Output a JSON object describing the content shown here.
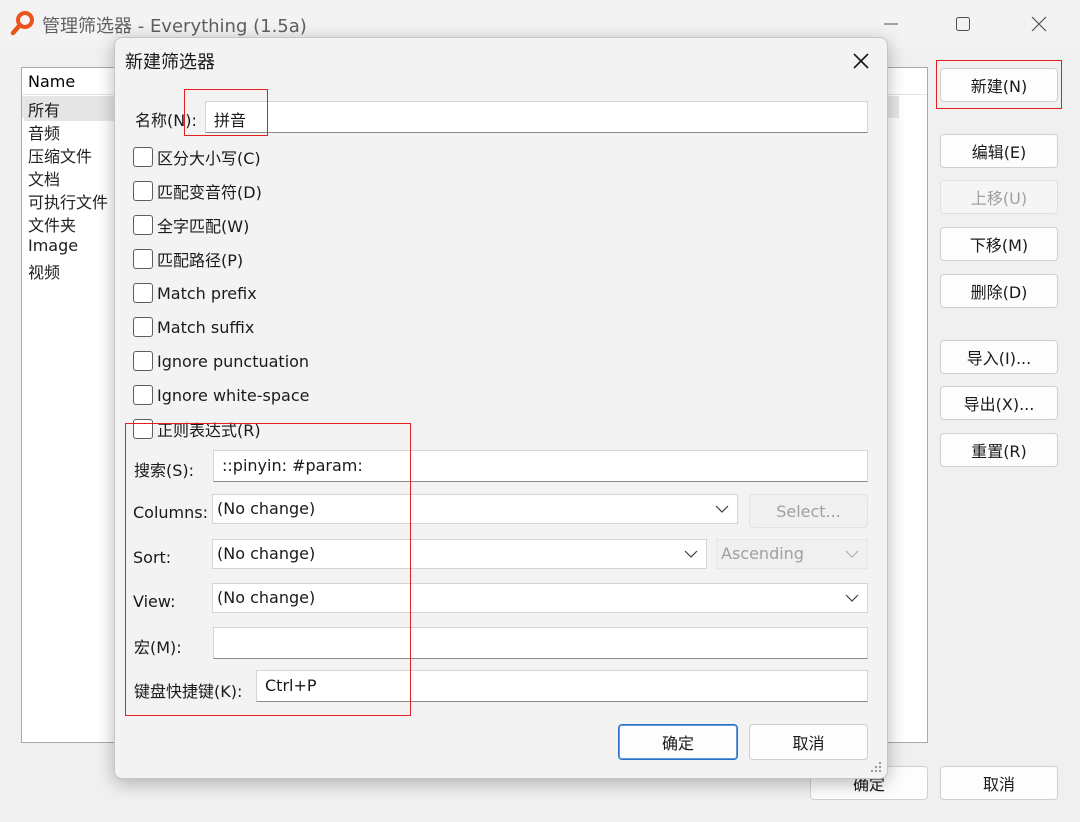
{
  "main_window": {
    "title": "管理筛选器 - Everything (1.5a)",
    "list_header": "Name",
    "filters": [
      "所有",
      "音频",
      "压缩文件",
      "文档",
      "可执行文件",
      "文件夹",
      "Image",
      "视频"
    ],
    "side_buttons": [
      {
        "label": "新建(N)",
        "enabled": true
      },
      {
        "label": "编辑(E)",
        "enabled": true
      },
      {
        "label": "上移(U)",
        "enabled": false
      },
      {
        "label": "下移(M)",
        "enabled": true
      },
      {
        "label": "删除(D)",
        "enabled": true
      },
      {
        "label": "导入(I)...",
        "enabled": true
      },
      {
        "label": "导出(X)...",
        "enabled": true
      },
      {
        "label": "重置(R)",
        "enabled": true
      }
    ],
    "ok_label": "确定",
    "cancel_label": "取消"
  },
  "dialog": {
    "title": "新建筛选器",
    "name_label": "名称(N):",
    "name_value": "拼音",
    "checkboxes": [
      {
        "label": "区分大小写(C)",
        "checked": false
      },
      {
        "label": "匹配变音符(D)",
        "checked": false
      },
      {
        "label": "全字匹配(W)",
        "checked": false
      },
      {
        "label": "匹配路径(P)",
        "checked": false
      },
      {
        "label": "Match prefix",
        "checked": false
      },
      {
        "label": "Match suffix",
        "checked": false
      },
      {
        "label": "Ignore punctuation",
        "checked": false
      },
      {
        "label": "Ignore white-space",
        "checked": false
      },
      {
        "label": "正则表达式(R)",
        "checked": false
      }
    ],
    "search_label": "搜索(S):",
    "search_value": "::pinyin: #param:",
    "columns_label": "Columns:",
    "columns_value": "(No change)",
    "select_button": "Select...",
    "sort_label": "Sort:",
    "sort_value": "(No change)",
    "sort_order_value": "Ascending",
    "view_label": "View:",
    "view_value": "(No change)",
    "macro_label": "宏(M):",
    "macro_value": "",
    "hotkey_label": "键盘快捷键(K):",
    "hotkey_value": "Ctrl+P",
    "ok_label": "确定",
    "cancel_label": "取消"
  },
  "colors": {
    "annotation_red": "#e02020",
    "primary_button_border": "#2f6fc8",
    "app_icon": "#e8541b"
  }
}
